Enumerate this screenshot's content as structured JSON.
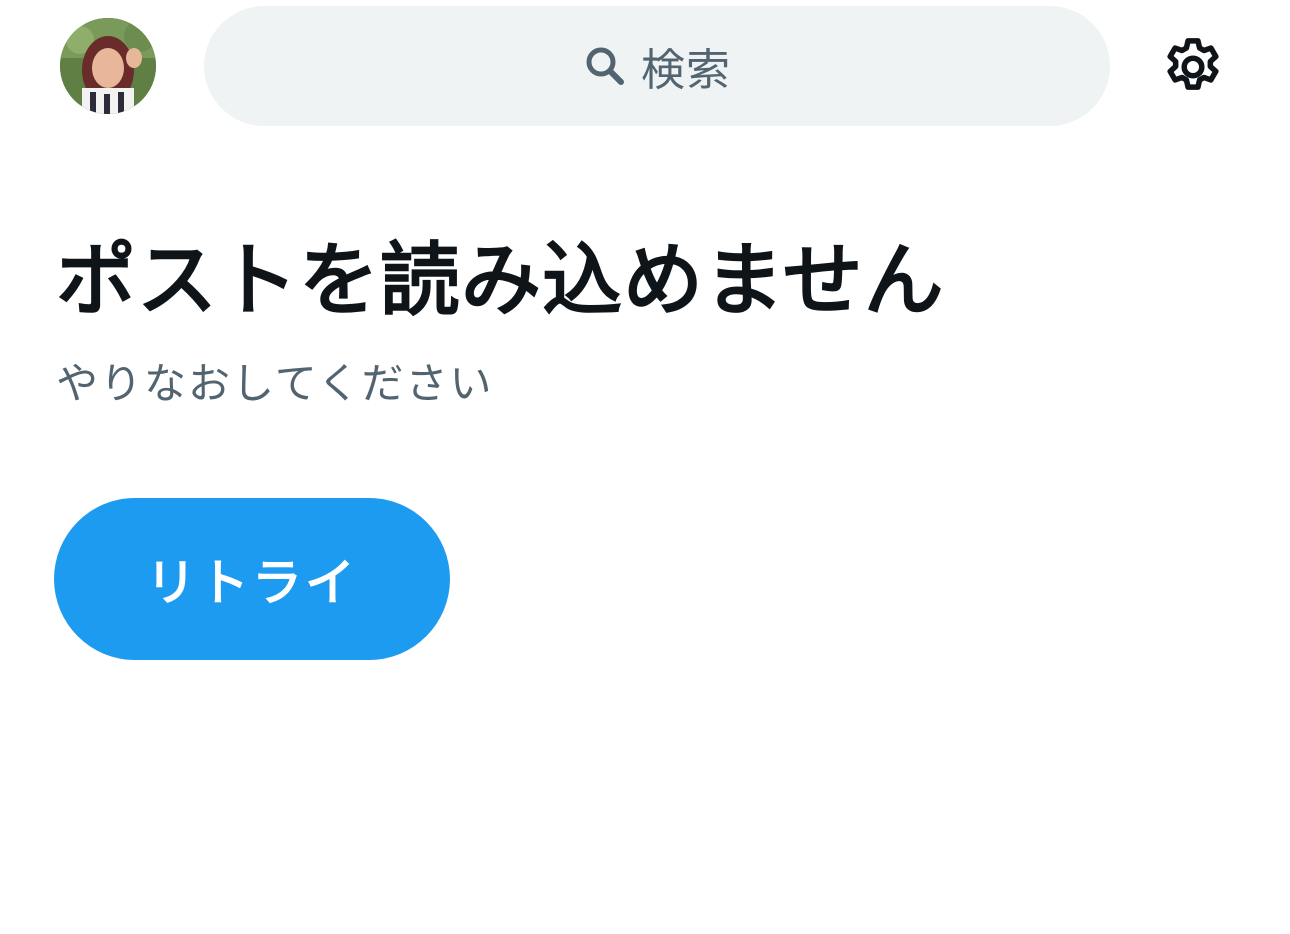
{
  "header": {
    "avatar_icon": "user-avatar",
    "search": {
      "icon": "search-icon",
      "placeholder": "検索"
    },
    "settings_icon": "gear-icon"
  },
  "error": {
    "title": "ポストを読み込めません",
    "subtitle": "やりなおしてください"
  },
  "actions": {
    "retry_label": "リトライ"
  },
  "colors": {
    "accent": "#1d9bf0",
    "search_bg": "#eff3f4",
    "primary_text": "#0f1419",
    "secondary_text": "#536471",
    "background": "#ffffff"
  }
}
